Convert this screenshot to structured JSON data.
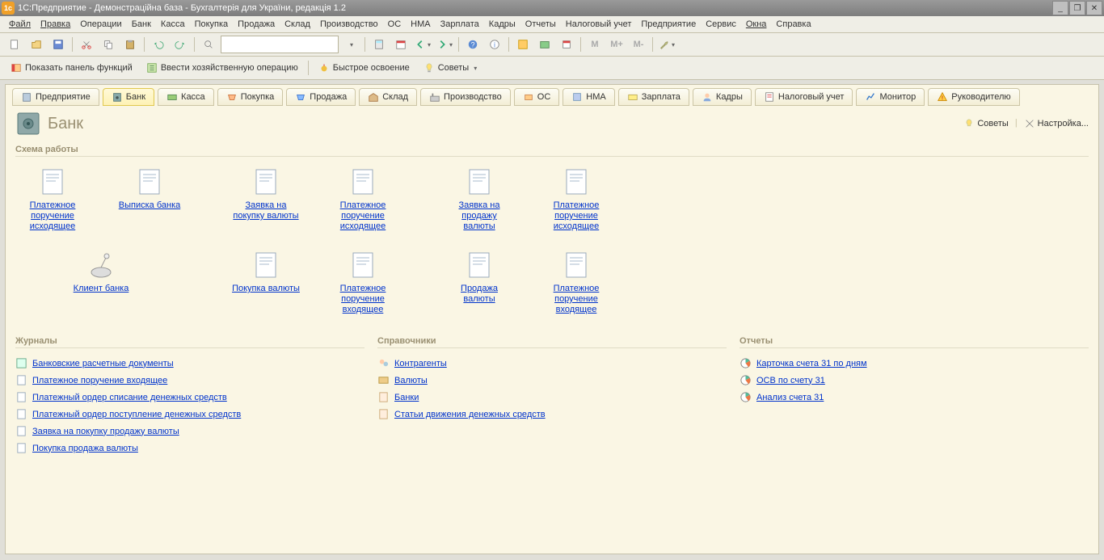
{
  "window": {
    "title": "1С:Предприятие - Демонстраційна база - Бухгалтерія для України, редакція 1.2"
  },
  "menu": [
    "Файл",
    "Правка",
    "Операции",
    "Банк",
    "Касса",
    "Покупка",
    "Продажа",
    "Склад",
    "Производство",
    "ОС",
    "НМА",
    "Зарплата",
    "Кадры",
    "Отчеты",
    "Налоговый учет",
    "Предприятие",
    "Сервис",
    "Окна",
    "Справка"
  ],
  "toolbar2": {
    "panel_fns": "Показать панель функций",
    "manual_op": "Ввести хозяйственную операцию",
    "quick_start": "Быстрое освоение",
    "tips": "Советы"
  },
  "tabs": [
    {
      "label": "Предприятие",
      "icon": "building"
    },
    {
      "label": "Банк",
      "icon": "safe",
      "active": true
    },
    {
      "label": "Касса",
      "icon": "cash"
    },
    {
      "label": "Покупка",
      "icon": "cart-in"
    },
    {
      "label": "Продажа",
      "icon": "cart-out"
    },
    {
      "label": "Склад",
      "icon": "warehouse"
    },
    {
      "label": "Производство",
      "icon": "factory"
    },
    {
      "label": "ОС",
      "icon": "asset"
    },
    {
      "label": "НМА",
      "icon": "intang"
    },
    {
      "label": "Зарплата",
      "icon": "payroll"
    },
    {
      "label": "Кадры",
      "icon": "people"
    },
    {
      "label": "Налоговый учет",
      "icon": "tax"
    },
    {
      "label": "Монитор",
      "icon": "monitor"
    },
    {
      "label": "Руководителю",
      "icon": "warn"
    }
  ],
  "panel": {
    "title": "Банк",
    "tips_link": "Советы",
    "settings_link": "Настройка..."
  },
  "schema_title": "Схема работы",
  "schema": {
    "c1r1": [
      {
        "label": "Платежное поручение исходящее"
      },
      {
        "label": "Выписка банка"
      }
    ],
    "c1r2": [
      {
        "label": "Клиент банка",
        "icon": "dish"
      }
    ],
    "c2r1": [
      {
        "label": "Заявка на покупку валюты"
      },
      {
        "label": "Платежное поручение исходящее"
      }
    ],
    "c2r2": [
      {
        "label": "Покупка валюты"
      },
      {
        "label": "Платежное поручение входящее"
      }
    ],
    "c3r1": [
      {
        "label": "Заявка на продажу валюты"
      },
      {
        "label": "Платежное поручение исходящее"
      }
    ],
    "c3r2": [
      {
        "label": "Продажа валюты"
      },
      {
        "label": "Платежное поручение входящее"
      }
    ]
  },
  "columns": {
    "journals": {
      "title": "Журналы",
      "items": [
        "Банковские расчетные документы",
        "Платежное поручение входящее",
        "Платежный ордер списание денежных средств",
        "Платежный ордер поступление денежных средств",
        "Заявка на покупку продажу валюты",
        "Покупка продажа валюты"
      ]
    },
    "refs": {
      "title": "Справочники",
      "items": [
        "Контрагенты",
        "Валюты",
        "Банки",
        "Статьи движения денежных средств"
      ]
    },
    "reports": {
      "title": "Отчеты",
      "items": [
        "Карточка счета 31 по дням",
        "ОСВ по счету 31",
        "Анализ счета 31"
      ]
    }
  }
}
